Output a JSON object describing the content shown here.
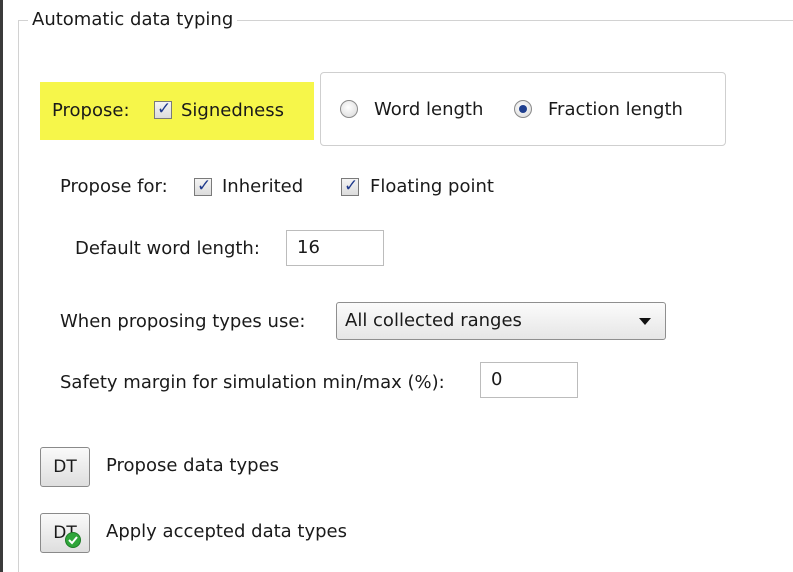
{
  "group": {
    "title": "Automatic data typing"
  },
  "propose": {
    "label": "Propose:",
    "signedness": {
      "label": "Signedness",
      "checked": true
    },
    "mode_options": [
      {
        "label": "Word length",
        "selected": false
      },
      {
        "label": "Fraction length",
        "selected": true
      }
    ],
    "highlight_color": "#f6f64a"
  },
  "propose_for": {
    "label": "Propose for:",
    "inherited": {
      "label": "Inherited",
      "checked": true
    },
    "floating_point": {
      "label": "Floating point",
      "checked": true
    }
  },
  "default_word_length": {
    "label": "Default word length:",
    "value": "16"
  },
  "proposing_types": {
    "label": "When proposing types use:",
    "selected": "All collected ranges"
  },
  "safety_margin": {
    "label": "Safety margin for simulation min/max (%):",
    "value": "0"
  },
  "actions": {
    "propose_button": {
      "label": "DT",
      "text": "Propose data types"
    },
    "apply_button": {
      "label": "DT",
      "text": "Apply accepted data types",
      "icon": "green-check-icon"
    }
  }
}
